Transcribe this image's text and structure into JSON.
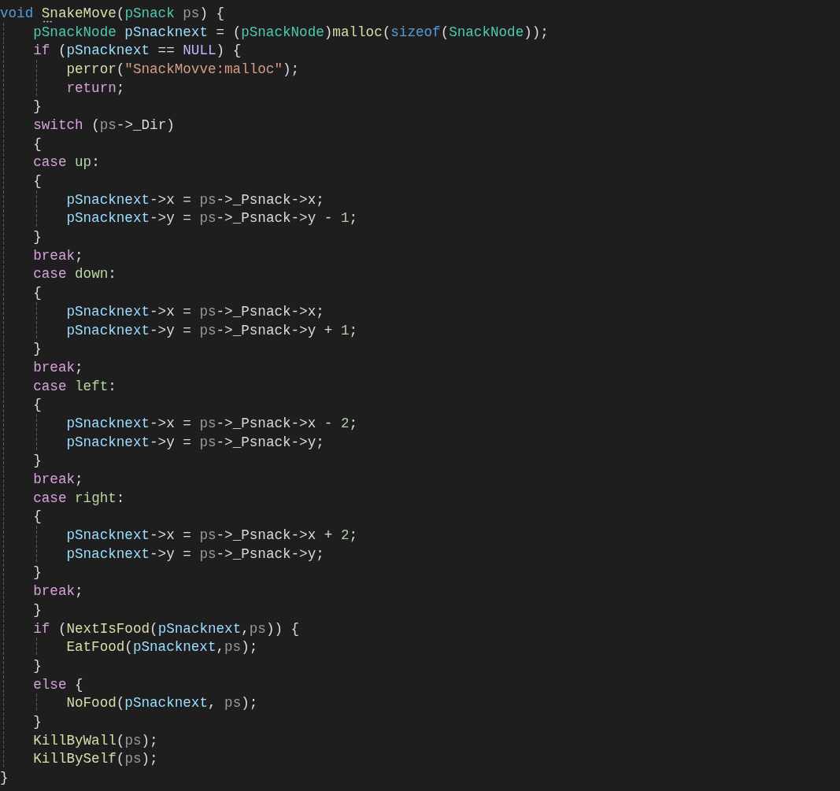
{
  "editor": {
    "lines": [
      {
        "tokens": [
          {
            "text": "void ",
            "kind": "kw"
          },
          {
            "text": "SnakeMove",
            "kind": "fn",
            "hint": true
          },
          {
            "text": "("
          },
          {
            "text": "pSnack ",
            "kind": "type"
          },
          {
            "text": "ps",
            "kind": "param"
          },
          {
            "text": ") {"
          }
        ],
        "children": [
          {
            "tokens": [
              {
                "text": "pSnackNode ",
                "kind": "type"
              },
              {
                "text": "pSnacknext",
                "kind": "var"
              },
              {
                "text": " = ("
              },
              {
                "text": "pSnackNode",
                "kind": "type"
              },
              {
                "text": ")"
              },
              {
                "text": "malloc",
                "kind": "fn"
              },
              {
                "text": "("
              },
              {
                "text": "sizeof",
                "kind": "kw"
              },
              {
                "text": "("
              },
              {
                "text": "SnackNode",
                "kind": "type"
              },
              {
                "text": "));"
              }
            ]
          },
          {
            "tokens": [
              {
                "text": "if",
                "kind": "ctl"
              },
              {
                "text": " ("
              },
              {
                "text": "pSnacknext",
                "kind": "var"
              },
              {
                "text": " == "
              },
              {
                "text": "NULL",
                "kind": "macro"
              },
              {
                "text": ") {"
              }
            ],
            "children": [
              {
                "tokens": [
                  {
                    "text": "perror",
                    "kind": "fn"
                  },
                  {
                    "text": "("
                  },
                  {
                    "text": "\"SnackMovve:malloc\"",
                    "kind": "str"
                  },
                  {
                    "text": ");"
                  }
                ]
              },
              {
                "tokens": [
                  {
                    "text": "return",
                    "kind": "ctl"
                  },
                  {
                    "text": ";"
                  }
                ]
              }
            ]
          },
          {
            "tokens": [
              {
                "text": "}"
              }
            ]
          },
          {
            "tokens": [
              {
                "text": "switch",
                "kind": "ctl"
              },
              {
                "text": " ("
              },
              {
                "text": "ps",
                "kind": "param"
              },
              {
                "text": "->"
              },
              {
                "text": "_Dir",
                "kind": "member"
              },
              {
                "text": ")"
              }
            ]
          },
          {
            "tokens": [
              {
                "text": "{"
              }
            ]
          },
          {
            "tokens": [
              {
                "text": "case ",
                "kind": "ctl"
              },
              {
                "text": "up",
                "kind": "enum"
              },
              {
                "text": ":"
              }
            ]
          },
          {
            "tokens": [
              {
                "text": "{"
              }
            ],
            "children": [
              {
                "tokens": [
                  {
                    "text": "pSnacknext",
                    "kind": "var"
                  },
                  {
                    "text": "->"
                  },
                  {
                    "text": "x",
                    "kind": "member"
                  },
                  {
                    "text": " = "
                  },
                  {
                    "text": "ps",
                    "kind": "param"
                  },
                  {
                    "text": "->"
                  },
                  {
                    "text": "_Psnack",
                    "kind": "member"
                  },
                  {
                    "text": "->"
                  },
                  {
                    "text": "x",
                    "kind": "member"
                  },
                  {
                    "text": ";"
                  }
                ]
              },
              {
                "tokens": [
                  {
                    "text": "pSnacknext",
                    "kind": "var"
                  },
                  {
                    "text": "->"
                  },
                  {
                    "text": "y",
                    "kind": "member"
                  },
                  {
                    "text": " = "
                  },
                  {
                    "text": "ps",
                    "kind": "param"
                  },
                  {
                    "text": "->"
                  },
                  {
                    "text": "_Psnack",
                    "kind": "member"
                  },
                  {
                    "text": "->"
                  },
                  {
                    "text": "y",
                    "kind": "member"
                  },
                  {
                    "text": " - "
                  },
                  {
                    "text": "1",
                    "kind": "num"
                  },
                  {
                    "text": ";"
                  }
                ]
              }
            ]
          },
          {
            "tokens": [
              {
                "text": "}"
              }
            ]
          },
          {
            "tokens": [
              {
                "text": "break",
                "kind": "ctl"
              },
              {
                "text": ";"
              }
            ]
          },
          {
            "tokens": [
              {
                "text": "case ",
                "kind": "ctl"
              },
              {
                "text": "down",
                "kind": "enum"
              },
              {
                "text": ":"
              }
            ]
          },
          {
            "tokens": [
              {
                "text": "{"
              }
            ],
            "children": [
              {
                "tokens": [
                  {
                    "text": "pSnacknext",
                    "kind": "var"
                  },
                  {
                    "text": "->"
                  },
                  {
                    "text": "x",
                    "kind": "member"
                  },
                  {
                    "text": " = "
                  },
                  {
                    "text": "ps",
                    "kind": "param"
                  },
                  {
                    "text": "->"
                  },
                  {
                    "text": "_Psnack",
                    "kind": "member"
                  },
                  {
                    "text": "->"
                  },
                  {
                    "text": "x",
                    "kind": "member"
                  },
                  {
                    "text": ";"
                  }
                ]
              },
              {
                "tokens": [
                  {
                    "text": "pSnacknext",
                    "kind": "var"
                  },
                  {
                    "text": "->"
                  },
                  {
                    "text": "y",
                    "kind": "member"
                  },
                  {
                    "text": " = "
                  },
                  {
                    "text": "ps",
                    "kind": "param"
                  },
                  {
                    "text": "->"
                  },
                  {
                    "text": "_Psnack",
                    "kind": "member"
                  },
                  {
                    "text": "->"
                  },
                  {
                    "text": "y",
                    "kind": "member"
                  },
                  {
                    "text": " + "
                  },
                  {
                    "text": "1",
                    "kind": "num"
                  },
                  {
                    "text": ";"
                  }
                ]
              }
            ]
          },
          {
            "tokens": [
              {
                "text": "}"
              }
            ]
          },
          {
            "tokens": [
              {
                "text": "break",
                "kind": "ctl"
              },
              {
                "text": ";"
              }
            ]
          },
          {
            "tokens": [
              {
                "text": "case ",
                "kind": "ctl"
              },
              {
                "text": "left",
                "kind": "enum"
              },
              {
                "text": ":"
              }
            ]
          },
          {
            "tokens": [
              {
                "text": "{"
              }
            ],
            "children": [
              {
                "tokens": [
                  {
                    "text": "pSnacknext",
                    "kind": "var"
                  },
                  {
                    "text": "->"
                  },
                  {
                    "text": "x",
                    "kind": "member"
                  },
                  {
                    "text": " = "
                  },
                  {
                    "text": "ps",
                    "kind": "param"
                  },
                  {
                    "text": "->"
                  },
                  {
                    "text": "_Psnack",
                    "kind": "member"
                  },
                  {
                    "text": "->"
                  },
                  {
                    "text": "x",
                    "kind": "member"
                  },
                  {
                    "text": " - "
                  },
                  {
                    "text": "2",
                    "kind": "num"
                  },
                  {
                    "text": ";"
                  }
                ]
              },
              {
                "tokens": [
                  {
                    "text": "pSnacknext",
                    "kind": "var"
                  },
                  {
                    "text": "->"
                  },
                  {
                    "text": "y",
                    "kind": "member"
                  },
                  {
                    "text": " = "
                  },
                  {
                    "text": "ps",
                    "kind": "param"
                  },
                  {
                    "text": "->"
                  },
                  {
                    "text": "_Psnack",
                    "kind": "member"
                  },
                  {
                    "text": "->"
                  },
                  {
                    "text": "y",
                    "kind": "member"
                  },
                  {
                    "text": ";"
                  }
                ]
              }
            ]
          },
          {
            "tokens": [
              {
                "text": "}"
              }
            ]
          },
          {
            "tokens": [
              {
                "text": "break",
                "kind": "ctl"
              },
              {
                "text": ";"
              }
            ]
          },
          {
            "tokens": [
              {
                "text": "case ",
                "kind": "ctl"
              },
              {
                "text": "right",
                "kind": "enum"
              },
              {
                "text": ":"
              }
            ]
          },
          {
            "tokens": [
              {
                "text": "{"
              }
            ],
            "children": [
              {
                "tokens": [
                  {
                    "text": "pSnacknext",
                    "kind": "var"
                  },
                  {
                    "text": "->"
                  },
                  {
                    "text": "x",
                    "kind": "member"
                  },
                  {
                    "text": " = "
                  },
                  {
                    "text": "ps",
                    "kind": "param"
                  },
                  {
                    "text": "->"
                  },
                  {
                    "text": "_Psnack",
                    "kind": "member"
                  },
                  {
                    "text": "->"
                  },
                  {
                    "text": "x",
                    "kind": "member"
                  },
                  {
                    "text": " + "
                  },
                  {
                    "text": "2",
                    "kind": "num"
                  },
                  {
                    "text": ";"
                  }
                ]
              },
              {
                "tokens": [
                  {
                    "text": "pSnacknext",
                    "kind": "var"
                  },
                  {
                    "text": "->"
                  },
                  {
                    "text": "y",
                    "kind": "member"
                  },
                  {
                    "text": " = "
                  },
                  {
                    "text": "ps",
                    "kind": "param"
                  },
                  {
                    "text": "->"
                  },
                  {
                    "text": "_Psnack",
                    "kind": "member"
                  },
                  {
                    "text": "->"
                  },
                  {
                    "text": "y",
                    "kind": "member"
                  },
                  {
                    "text": ";"
                  }
                ]
              }
            ]
          },
          {
            "tokens": [
              {
                "text": "}"
              }
            ]
          },
          {
            "tokens": [
              {
                "text": "break",
                "kind": "ctl"
              },
              {
                "text": ";"
              }
            ]
          },
          {
            "tokens": [
              {
                "text": "}"
              }
            ]
          },
          {
            "tokens": [
              {
                "text": "if",
                "kind": "ctl"
              },
              {
                "text": " ("
              },
              {
                "text": "NextIsFood",
                "kind": "fn"
              },
              {
                "text": "("
              },
              {
                "text": "pSnacknext",
                "kind": "var"
              },
              {
                "text": ","
              },
              {
                "text": "ps",
                "kind": "param"
              },
              {
                "text": ")) {"
              }
            ],
            "children": [
              {
                "tokens": [
                  {
                    "text": "EatFood",
                    "kind": "fn"
                  },
                  {
                    "text": "("
                  },
                  {
                    "text": "pSnacknext",
                    "kind": "var"
                  },
                  {
                    "text": ","
                  },
                  {
                    "text": "ps",
                    "kind": "param"
                  },
                  {
                    "text": ");"
                  }
                ]
              }
            ]
          },
          {
            "tokens": [
              {
                "text": "}"
              }
            ]
          },
          {
            "tokens": [
              {
                "text": "else",
                "kind": "ctl"
              },
              {
                "text": " {"
              }
            ],
            "children": [
              {
                "tokens": [
                  {
                    "text": "NoFood",
                    "kind": "fn"
                  },
                  {
                    "text": "("
                  },
                  {
                    "text": "pSnacknext",
                    "kind": "var"
                  },
                  {
                    "text": ", "
                  },
                  {
                    "text": "ps",
                    "kind": "param"
                  },
                  {
                    "text": ");"
                  }
                ]
              }
            ]
          },
          {
            "tokens": [
              {
                "text": "}"
              }
            ]
          },
          {
            "tokens": [
              {
                "text": "KillByWall",
                "kind": "fn"
              },
              {
                "text": "("
              },
              {
                "text": "ps",
                "kind": "param"
              },
              {
                "text": ");"
              }
            ]
          },
          {
            "tokens": [
              {
                "text": "KillBySelf",
                "kind": "fn"
              },
              {
                "text": "("
              },
              {
                "text": "ps",
                "kind": "param"
              },
              {
                "text": ");"
              }
            ]
          }
        ]
      },
      {
        "tokens": [
          {
            "text": "}"
          }
        ]
      }
    ]
  }
}
